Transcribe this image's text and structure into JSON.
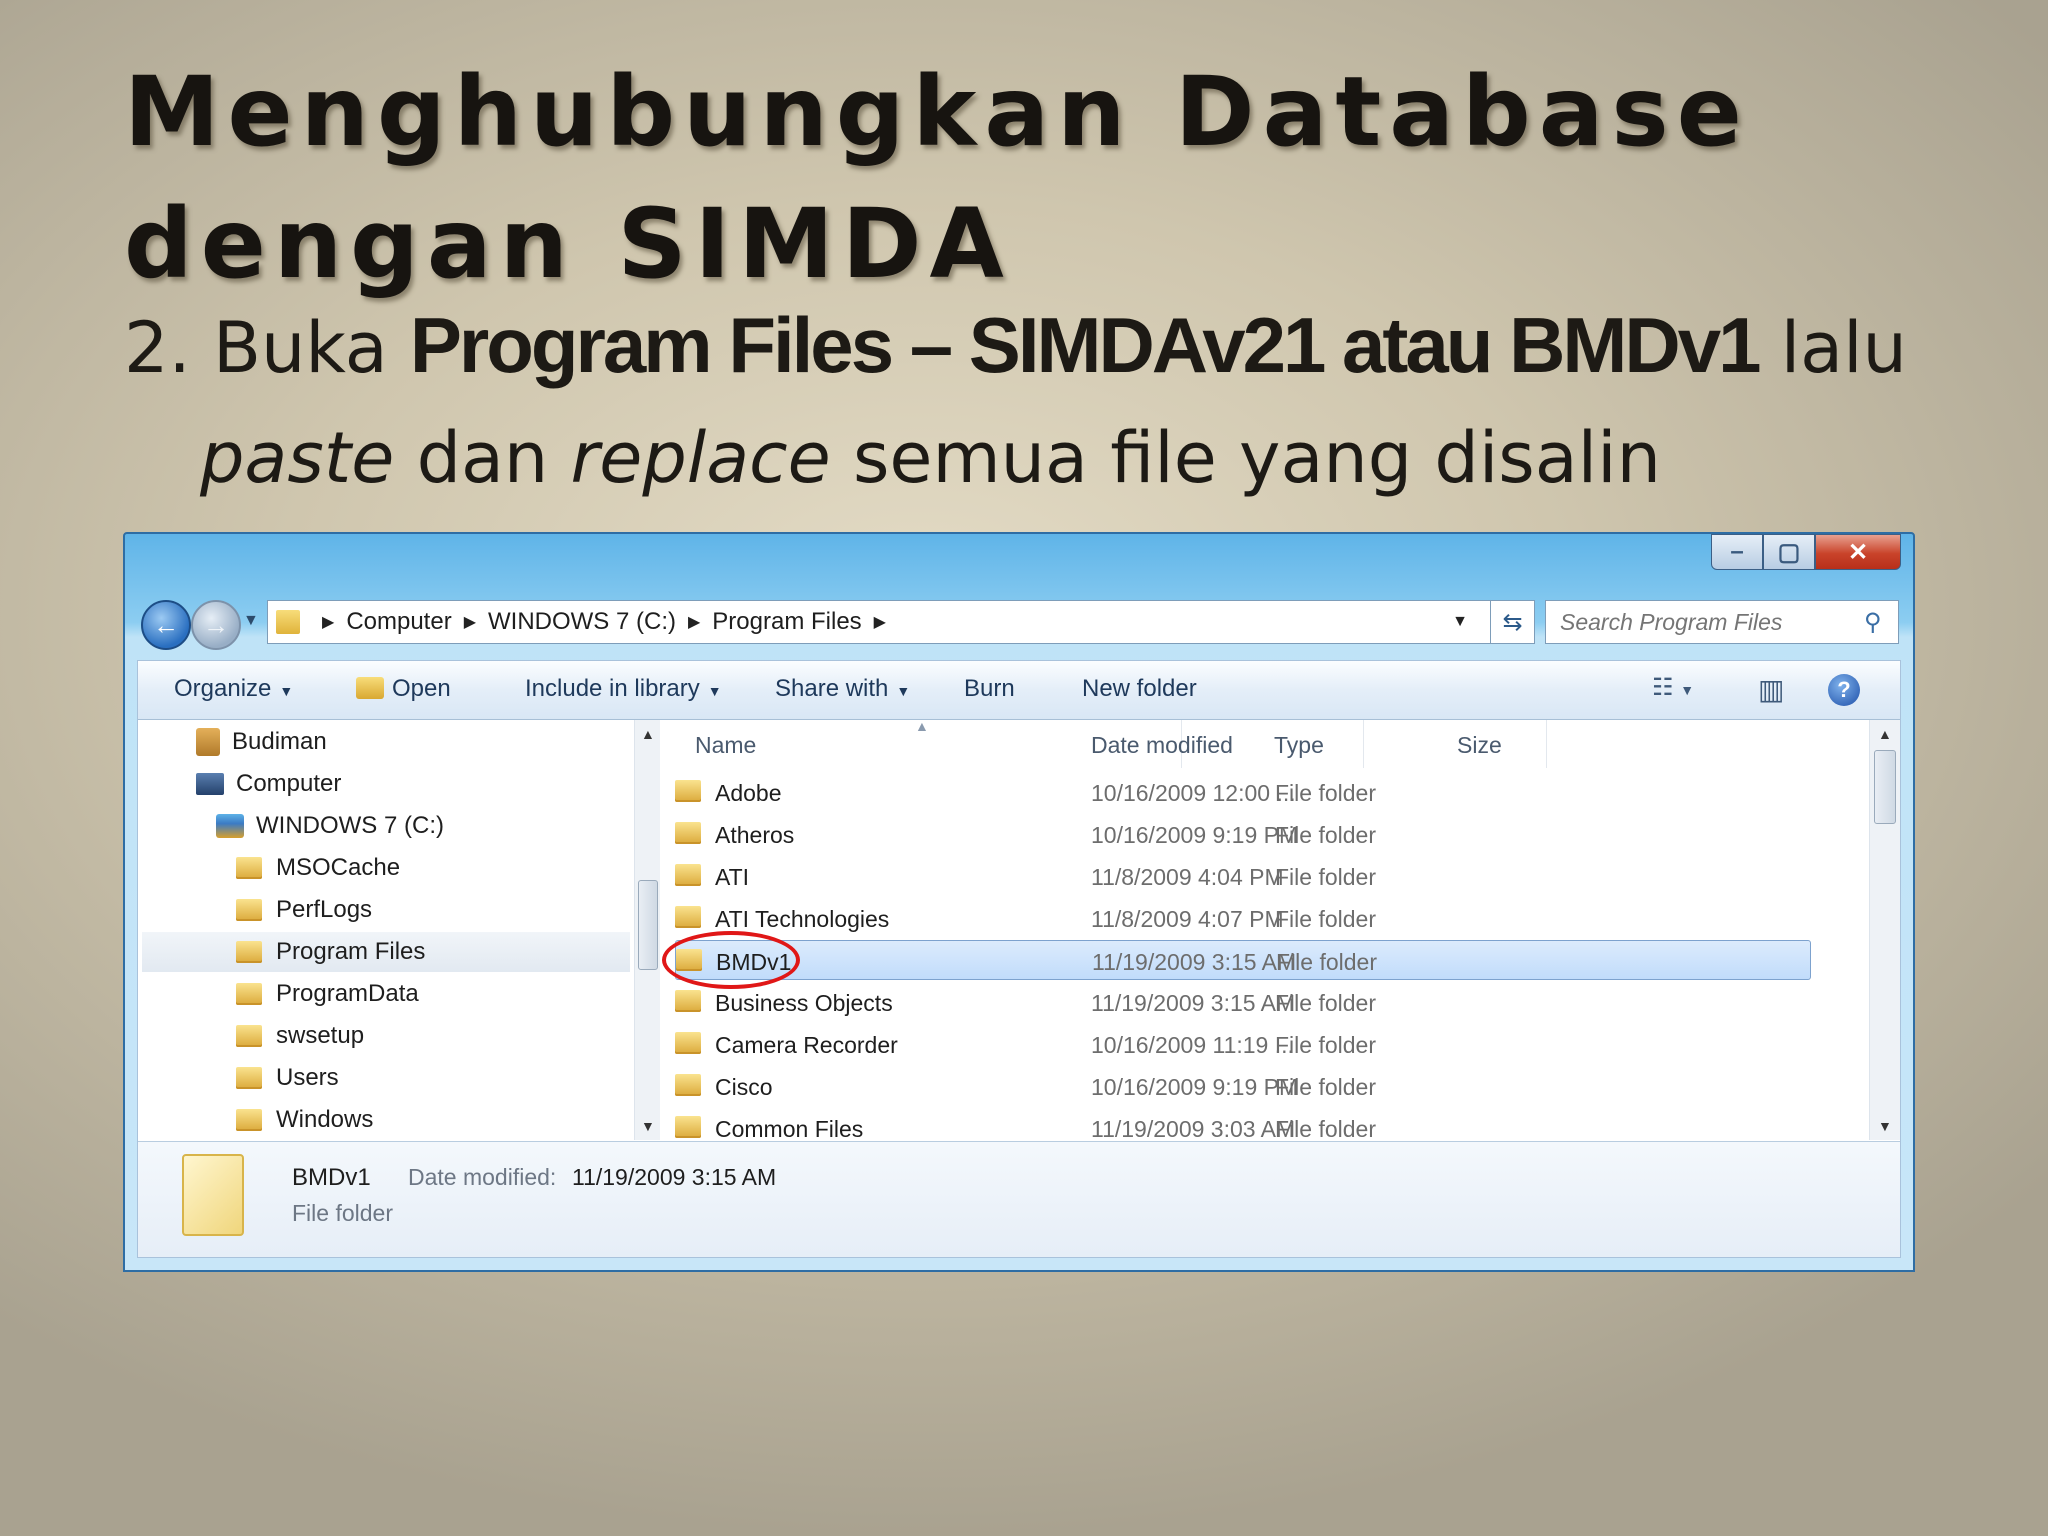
{
  "slide": {
    "title_line1": "Menghubungkan Database",
    "title_line2": "dengan SIMDA",
    "bullet_prefix": "2. Buka ",
    "bullet_bold": "Program Files – SIMDAv21  atau BMDv1",
    "bullet_after": " lalu",
    "bullet_line2_em1": "paste",
    "bullet_line2_mid": " dan ",
    "bullet_line2_em2": "replace",
    "bullet_line2_end": " semua file yang disalin"
  },
  "window": {
    "controls": {
      "minimize": "–",
      "maximize": "▢",
      "close": "✕"
    },
    "breadcrumb": [
      "Computer",
      "WINDOWS 7 (C:)",
      "Program Files"
    ],
    "search_placeholder": "Search Program Files"
  },
  "toolbar": {
    "organize": "Organize",
    "open": "Open",
    "include_in_library": "Include in library",
    "share_with": "Share with",
    "burn": "Burn",
    "new_folder": "New folder"
  },
  "nav_pane": {
    "items": [
      {
        "label": "Budiman",
        "icon": "user-folder-icon"
      },
      {
        "label": "Computer",
        "icon": "computer-icon"
      },
      {
        "label": "WINDOWS 7 (C:)",
        "icon": "drive-icon"
      },
      {
        "label": "MSOCache",
        "icon": "folder-icon"
      },
      {
        "label": "PerfLogs",
        "icon": "folder-icon"
      },
      {
        "label": "Program Files",
        "icon": "folder-icon",
        "selected": true
      },
      {
        "label": "ProgramData",
        "icon": "folder-icon"
      },
      {
        "label": "swsetup",
        "icon": "folder-icon"
      },
      {
        "label": "Users",
        "icon": "folder-icon"
      },
      {
        "label": "Windows",
        "icon": "folder-icon"
      }
    ]
  },
  "file_list": {
    "columns": {
      "name": "Name",
      "date_modified": "Date modified",
      "type": "Type",
      "size": "Size"
    },
    "rows": [
      {
        "name": "Adobe",
        "date": "10/16/2009 12:00 ...",
        "type": "File folder"
      },
      {
        "name": "Atheros",
        "date": "10/16/2009 9:19 PM",
        "type": "File folder"
      },
      {
        "name": "ATI",
        "date": "11/8/2009 4:04 PM",
        "type": "File folder"
      },
      {
        "name": "ATI Technologies",
        "date": "11/8/2009 4:07 PM",
        "type": "File folder"
      },
      {
        "name": "BMDv1",
        "date": "11/19/2009 3:15 AM",
        "type": "File folder",
        "selected": true
      },
      {
        "name": "Business Objects",
        "date": "11/19/2009 3:15 AM",
        "type": "File folder"
      },
      {
        "name": "Camera Recorder",
        "date": "10/16/2009 11:19 ...",
        "type": "File folder"
      },
      {
        "name": "Cisco",
        "date": "10/16/2009 9:19 PM",
        "type": "File folder"
      },
      {
        "name": "Common Files",
        "date": "11/19/2009 3:03 AM",
        "type": "File folder"
      }
    ]
  },
  "details": {
    "name": "BMDv1",
    "date_label": "Date modified:",
    "date_value": "11/19/2009 3:15 AM",
    "type": "File folder"
  },
  "colors": {
    "highlight_ring": "#e01717",
    "selection": "#c1dcfb"
  }
}
